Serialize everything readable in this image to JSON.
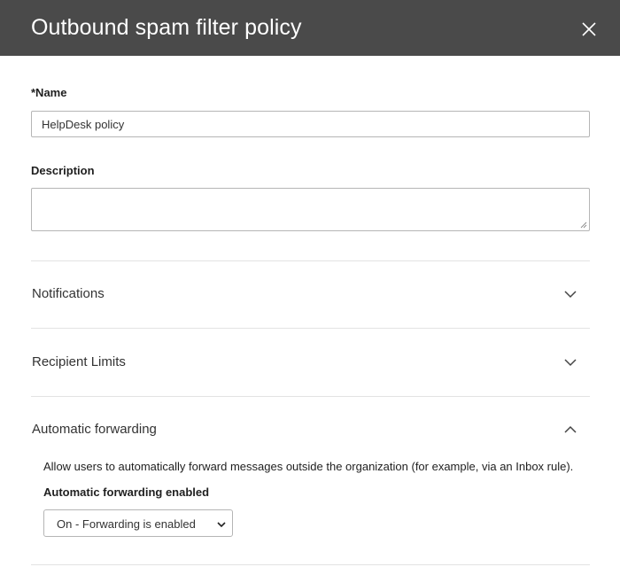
{
  "panel": {
    "title": "Outbound spam filter policy",
    "close_icon": "close-icon"
  },
  "name_field": {
    "label": "*Name",
    "value": "HelpDesk policy"
  },
  "description_field": {
    "label": "Description",
    "value": ""
  },
  "sections": [
    {
      "title": "Notifications",
      "expanded": false,
      "icon": "chevron-down-icon"
    },
    {
      "title": "Recipient Limits",
      "expanded": false,
      "icon": "chevron-down-icon"
    },
    {
      "title": "Automatic forwarding",
      "expanded": true,
      "icon": "chevron-up-icon"
    }
  ],
  "automatic_forwarding": {
    "description": "Allow users to automatically forward messages outside the organization (for example, via an Inbox rule).",
    "select_label": "Automatic forwarding enabled",
    "selected_option": "On - Forwarding is enabled"
  },
  "colors": {
    "header_bg": "#4a4a4a",
    "header_text": "#ffffff",
    "border": "#b5b5b5",
    "divider": "#e3e3e3"
  }
}
